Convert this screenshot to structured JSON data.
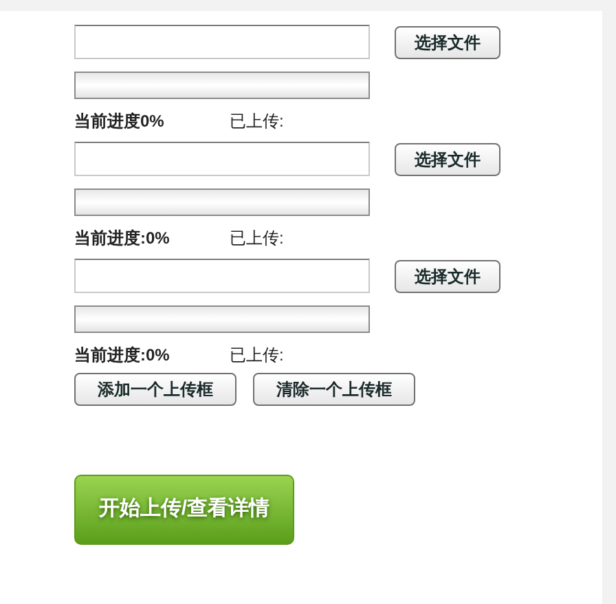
{
  "uploads": [
    {
      "button": "选择文件",
      "level": 0,
      "progress": "当前进度0%",
      "uploaded": "已上传:"
    },
    {
      "button": "选择文件",
      "level": 0,
      "progress": "当前进度:0%",
      "uploaded": "已上传:"
    },
    {
      "button": "选择文件",
      "level": 0,
      "progress": "当前进度:0%",
      "uploaded": "已上传:"
    }
  ],
  "actions": [
    "添加一个上传框",
    "清除一个上传框"
  ],
  "submit": "开始上传/查看详情"
}
